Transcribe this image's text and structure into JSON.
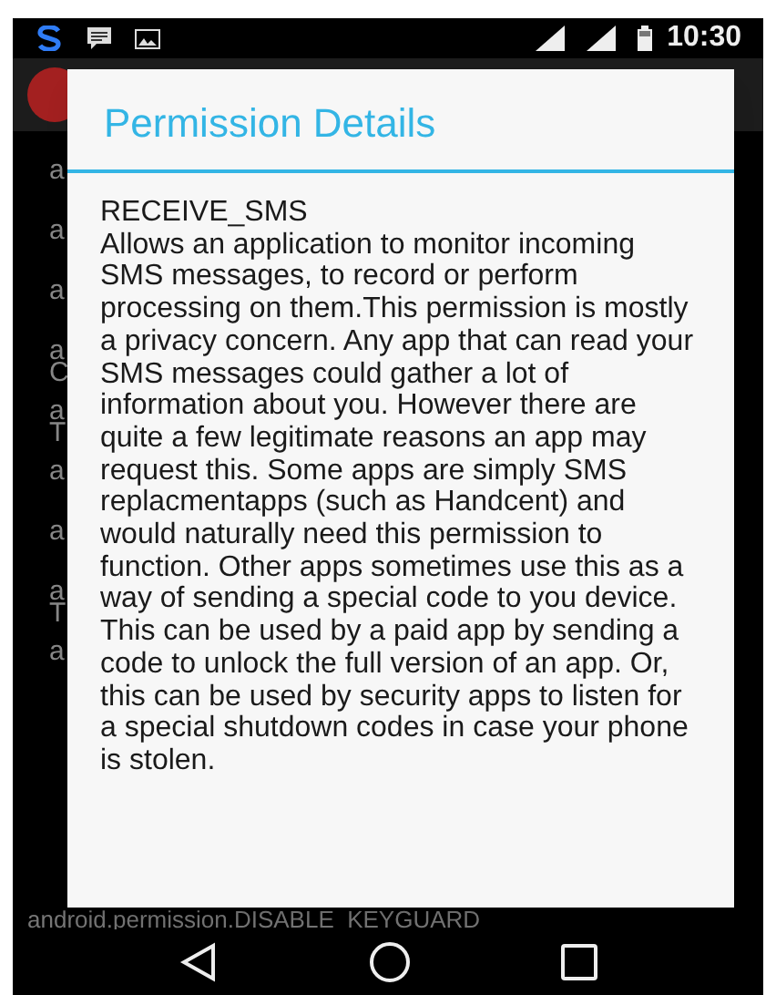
{
  "status_bar": {
    "time": "10:30"
  },
  "background_list": [
    {
      "lines": [
        "a"
      ]
    },
    {
      "lines": [
        "a"
      ]
    },
    {
      "lines": [
        "a"
      ]
    },
    {
      "lines": [
        "a",
        "C"
      ]
    },
    {
      "lines": [
        "a",
        "T"
      ]
    },
    {
      "lines": [
        "a"
      ]
    },
    {
      "lines": [
        "a"
      ]
    },
    {
      "lines": [
        "a",
        "T"
      ]
    },
    {
      "lines": [
        "a"
      ]
    }
  ],
  "background_footer": "android.permission.DISABLE_KEYGUARD",
  "dialog": {
    "title": "Permission Details",
    "permission": "RECEIVE_SMS",
    "description": "Allows an application to monitor incoming SMS messages, to record or perform processing on them.This permission is mostly a privacy concern. Any app that can read your SMS messages could gather a lot of information about you. However there are quite a few legitimate reasons an app may request this. Some apps are simply SMS replacmentapps (such as Handcent) and would naturally need this permission to function. Other apps sometimes use this as a way of sending a special code to you device. This can be used by a paid app by sending a code to unlock the full version of an app. Or, this can be used by security apps to listen for a special shutdown codes in case your phone is stolen."
  }
}
